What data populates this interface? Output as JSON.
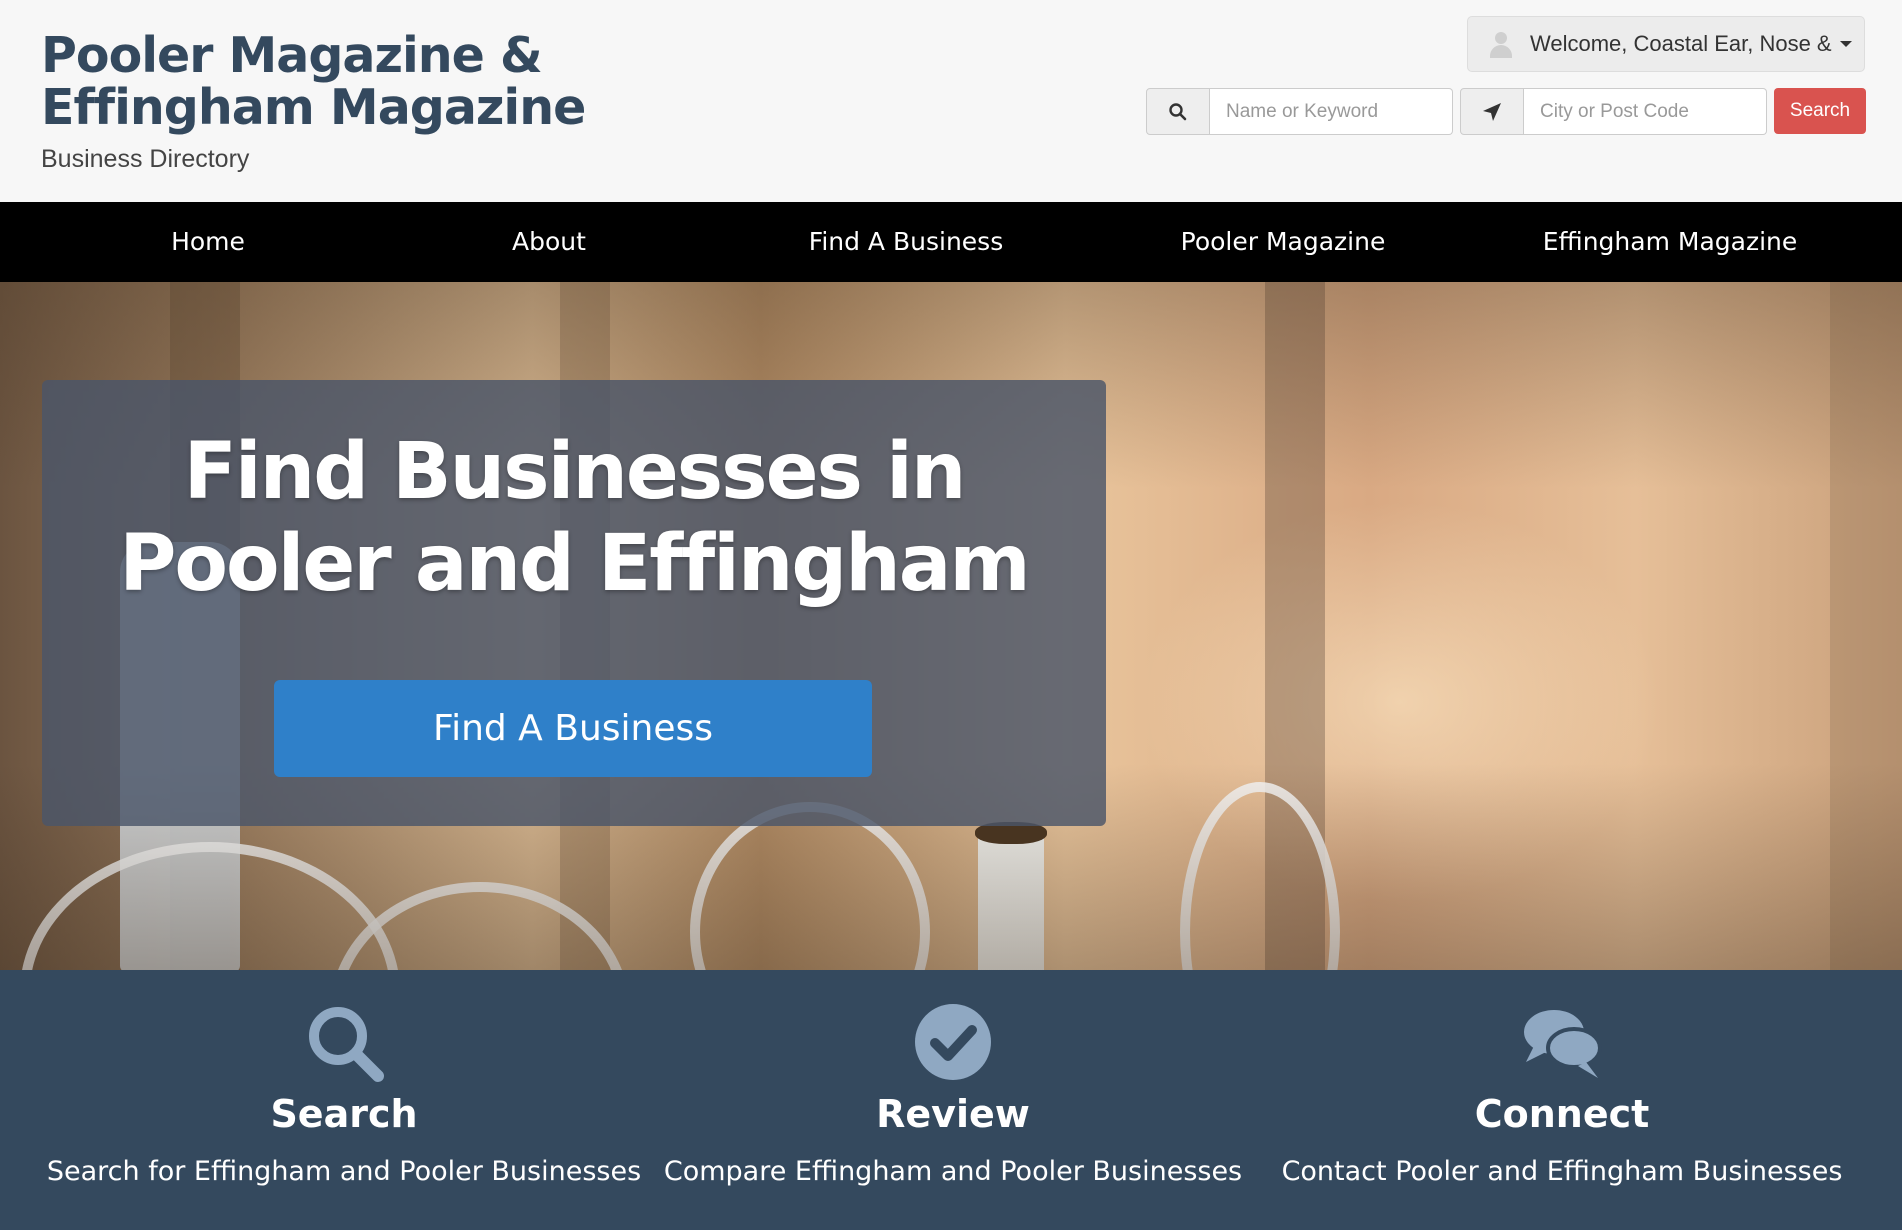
{
  "header": {
    "title": "Pooler Magazine & Effingham Magazine",
    "subtitle": "Business Directory",
    "welcome": "Welcome, Coastal Ear, Nose &",
    "keyword_placeholder": "Name or Keyword",
    "location_placeholder": "City or Post Code",
    "search_label": "Search"
  },
  "nav": {
    "items": [
      {
        "label": "Home"
      },
      {
        "label": "About"
      },
      {
        "label": "Find A Business"
      },
      {
        "label": "Pooler Magazine"
      },
      {
        "label": "Effingham Magazine"
      }
    ]
  },
  "hero": {
    "title": "Find Businesses in Pooler and Effingham",
    "button": "Find A Business"
  },
  "features": [
    {
      "icon": "search-icon",
      "title": "Search",
      "description": "Search for Effingham and Pooler Businesses"
    },
    {
      "icon": "check-circle-icon",
      "title": "Review",
      "description": "Compare Effingham and Pooler Businesses"
    },
    {
      "icon": "chat-bubbles-icon",
      "title": "Connect",
      "description": "Contact Pooler and Effingham Businesses"
    }
  ],
  "colors": {
    "brand_text": "#34495e",
    "nav_bg": "#000000",
    "search_button": "#d9534f",
    "hero_button": "#2f80c9",
    "features_bg": "#34495e",
    "feature_icon": "#8fa8c2"
  }
}
